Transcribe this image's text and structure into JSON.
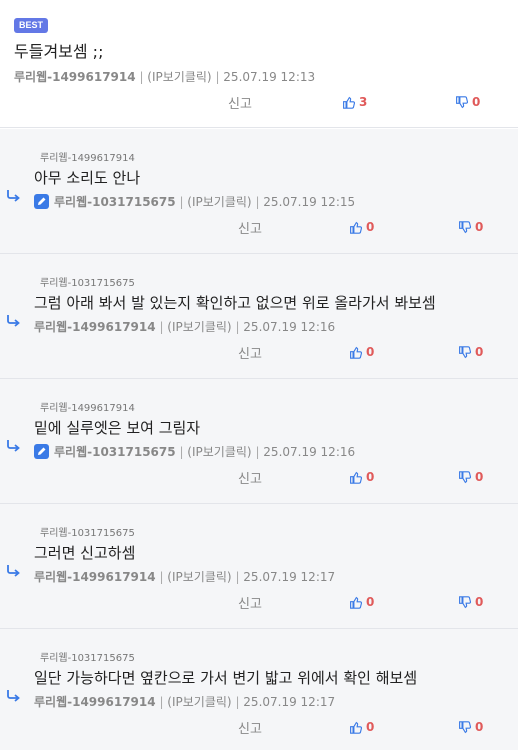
{
  "best": {
    "badge": "BEST",
    "text": "두들겨보셈 ;;",
    "author": "루리웹-1499617914",
    "ip_label": "(IP보기클릭)",
    "datetime": "25.07.19 12:13",
    "report_label": "신고",
    "likes": "3",
    "dislikes": "0"
  },
  "replies": [
    {
      "reply_to": "루리웹-1499617914",
      "text": "아무 소리도 안나",
      "author": "루리웹-1031715675",
      "edited": true,
      "ip_label": "(IP보기클릭)",
      "datetime": "25.07.19 12:15",
      "report_label": "신고",
      "likes": "0",
      "dislikes": "0"
    },
    {
      "reply_to": "루리웹-1031715675",
      "text": "그럼 아래 봐서 발 있는지 확인하고 없으면 위로 올라가서 봐보셈",
      "author": "루리웹-1499617914",
      "edited": false,
      "ip_label": "(IP보기클릭)",
      "datetime": "25.07.19 12:16",
      "report_label": "신고",
      "likes": "0",
      "dislikes": "0"
    },
    {
      "reply_to": "루리웹-1499617914",
      "text": "밑에 실루엣은 보여 그림자",
      "author": "루리웹-1031715675",
      "edited": true,
      "ip_label": "(IP보기클릭)",
      "datetime": "25.07.19 12:16",
      "report_label": "신고",
      "likes": "0",
      "dislikes": "0"
    },
    {
      "reply_to": "루리웹-1031715675",
      "text": "그러면 신고하셈",
      "author": "루리웹-1499617914",
      "edited": false,
      "ip_label": "(IP보기클릭)",
      "datetime": "25.07.19 12:17",
      "report_label": "신고",
      "likes": "0",
      "dislikes": "0"
    },
    {
      "reply_to": "루리웹-1031715675",
      "text": "일단 가능하다면 옆칸으로 가서 변기 밟고 위에서 확인 해보셈",
      "author": "루리웹-1499617914",
      "edited": false,
      "ip_label": "(IP보기클릭)",
      "datetime": "25.07.19 12:17",
      "report_label": "신고",
      "likes": "0",
      "dislikes": "0"
    }
  ],
  "colors": {
    "badge": "#6378e6",
    "thumb_up": "#3a7ae6",
    "vote_count": "#e05a5a",
    "reply_bg": "#f5f6f8"
  },
  "icons": [
    "thumbs-up-icon",
    "thumbs-down-icon",
    "reply-arrow-icon",
    "pencil-icon"
  ]
}
